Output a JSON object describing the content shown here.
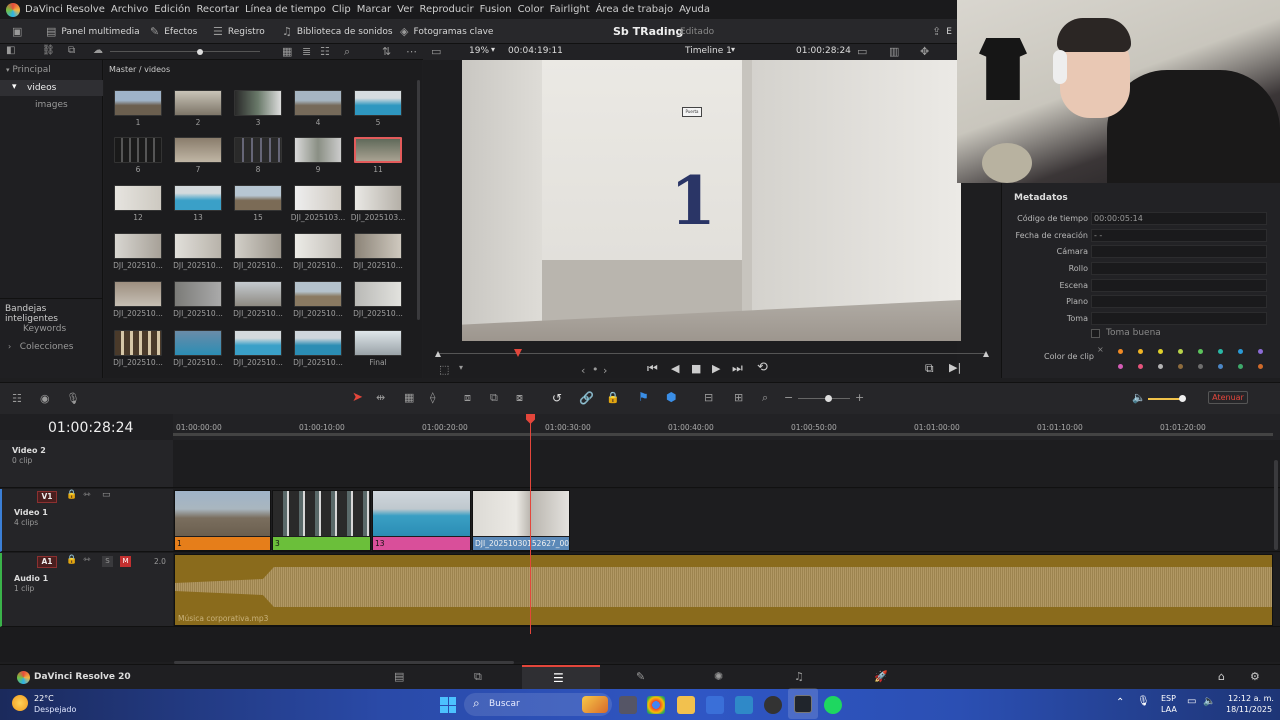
{
  "menu": {
    "app": "DaVinci Resolve",
    "items": [
      "Archivo",
      "Edición",
      "Recortar",
      "Línea de tiempo",
      "Clip",
      "Marcar",
      "Ver",
      "Reproducir",
      "Fusion",
      "Color",
      "Fairlight",
      "Área de trabajo",
      "Ayuda"
    ]
  },
  "toolbar": {
    "media_pool": "Panel multimedia",
    "effects": "Efectos",
    "log": "Registro",
    "sound_library": "Biblioteca de sonidos",
    "keyframes": "Fotogramas clave",
    "project": "Sb TRading",
    "status": "Editado",
    "right_label": "E"
  },
  "viewerbar": {
    "zoom": "19%",
    "source_tc": "00:04:19:11",
    "timeline": "Timeline 1",
    "record_tc": "01:00:28:24"
  },
  "left_panel": {
    "master": "Principal",
    "folder": "videos",
    "subfolder": "images",
    "smart_bins": "Bandejas inteligentes",
    "keywords": "Keywords",
    "collections": "Colecciones"
  },
  "media_pool": {
    "path": "Master / videos",
    "clips": [
      "1",
      "2",
      "3",
      "4",
      "5",
      "6",
      "7",
      "8",
      "9",
      "11",
      "12",
      "13",
      "15",
      "DJI_2025103...",
      "DJI_2025103...",
      "DJI_202510...",
      "DJI_202510...",
      "DJI_202510...",
      "DJI_202510...",
      "DJI_202510...",
      "DJI_202510...",
      "DJI_202510...",
      "DJI_202510...",
      "DJI_202510...",
      "DJI_202510...",
      "DJI_202510...",
      "DJI_202510...",
      "DJI_202510...",
      "DJI_202510...",
      "Final"
    ]
  },
  "viewer": {
    "door_number": "1",
    "door_sign": "Puerta"
  },
  "metadata": {
    "title": "Metadatos",
    "fields": [
      {
        "label": "Código de tiempo",
        "value": "00:00:05:14"
      },
      {
        "label": "Fecha de creación",
        "value": "- -"
      },
      {
        "label": "Cámara",
        "value": ""
      },
      {
        "label": "Rollo",
        "value": ""
      },
      {
        "label": "Escena",
        "value": ""
      },
      {
        "label": "Plano",
        "value": ""
      },
      {
        "label": "Toma",
        "value": ""
      }
    ],
    "good_take": "Toma buena",
    "clip_color": "Color de clip",
    "clip_colors": [
      "#f08a24",
      "#f0b424",
      "#e0d02a",
      "#b8d24a",
      "#5cc25c",
      "#2ab7a6",
      "#2a9ad6",
      "#8c6cd6",
      "#d45cb6",
      "#e6537a",
      "#b4b4b4",
      "#8e6b3c",
      "#6e6e6e",
      "#4a86c6",
      "#3ea86a",
      "#d06a2a"
    ]
  },
  "edit_tools": {
    "mute_label": "Atenuar"
  },
  "timeline": {
    "timecode": "01:00:28:24",
    "ruler": [
      "01:00:00:00",
      "01:00:10:00",
      "01:00:20:00",
      "01:00:30:00",
      "01:00:40:00",
      "01:00:50:00",
      "01:01:00:00",
      "01:01:10:00",
      "01:01:20:00"
    ],
    "tracks": [
      {
        "name": "Video 2",
        "count": "0 clip"
      },
      {
        "id": "V1",
        "name": "Video 1",
        "count": "4 clips"
      },
      {
        "id": "A1",
        "name": "Audio 1",
        "count": "1 clip",
        "level": "2.0",
        "solo": "S",
        "mute": "M"
      }
    ],
    "video_clips": [
      {
        "label": "1",
        "color": "#e67e1a"
      },
      {
        "label": "3",
        "color": "#6bbf3a"
      },
      {
        "label": "13",
        "color": "#d94f9a"
      },
      {
        "label": "DJI_20251030152627_004...",
        "color": "#5b89b8"
      }
    ],
    "audio_clip": "Música corporativa.mp3"
  },
  "pagebar": {
    "app": "DaVinci Resolve 20"
  },
  "taskbar": {
    "temp": "22°C",
    "weather": "Despejado",
    "search": "Buscar",
    "lang1": "ESP",
    "lang2": "LAA",
    "time": "12:12 a. m.",
    "date": "18/11/2025"
  }
}
